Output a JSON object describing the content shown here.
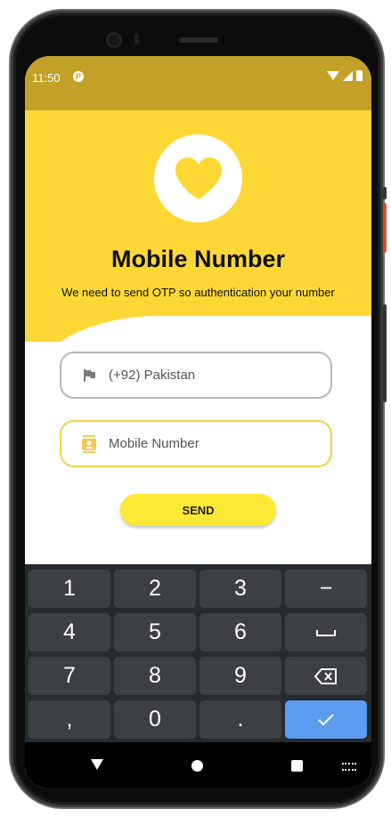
{
  "status_bar": {
    "time": "11:50",
    "app_icon_glyph": "P",
    "color": "#c3a128",
    "icons": [
      "wifi-icon",
      "signal-icon",
      "battery-icon"
    ]
  },
  "header": {
    "logo_icon": "heart-icon",
    "title": "Mobile Number",
    "subtitle": "We need to send OTP so authentication your number",
    "background_color": "#fdd835"
  },
  "form": {
    "country_field": {
      "icon": "flag-icon",
      "value": "(+92) Pakistan"
    },
    "mobile_field": {
      "icon": "contact-card-icon",
      "placeholder": "Mobile Number"
    },
    "send_label": "SEND",
    "send_color": "#fde835"
  },
  "keyboard": {
    "rows": [
      [
        "1",
        "2",
        "3",
        "−"
      ],
      [
        "4",
        "5",
        "6",
        "␣"
      ],
      [
        "7",
        "8",
        "9",
        "⌫"
      ],
      [
        ",",
        "0",
        ".",
        "✓"
      ]
    ],
    "done_color": "#5b9cf0"
  },
  "nav_bar": {
    "icons": [
      "back-icon",
      "home-icon",
      "recents-icon",
      "keyboard-switch-icon"
    ]
  }
}
